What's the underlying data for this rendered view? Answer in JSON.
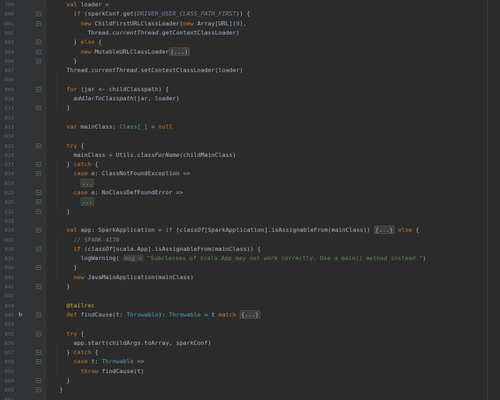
{
  "editor": {
    "lines": [
      {
        "n": "799",
        "fold": false,
        "segs": [
          {
            "c": "      "
          },
          {
            "c": "val",
            "k": "kw"
          },
          {
            "c": " loader ="
          }
        ]
      },
      {
        "n": "800",
        "fold": true,
        "segs": [
          {
            "c": "        "
          },
          {
            "c": "if",
            "k": "kw"
          },
          {
            "c": " (sparkConf.get("
          },
          {
            "c": "DRIVER_USER_CLASS_PATH_FIRST",
            "k": "const"
          },
          {
            "c": ")) {"
          }
        ]
      },
      {
        "n": "801",
        "fold": true,
        "segs": [
          {
            "c": "          "
          },
          {
            "c": "new",
            "k": "kw"
          },
          {
            "c": " ChildFirstURLClassLoader("
          },
          {
            "c": "new",
            "k": "kw"
          },
          {
            "c": " Array[URL]("
          },
          {
            "c": "0",
            "k": "num"
          },
          {
            "c": "),"
          }
        ]
      },
      {
        "n": "802",
        "fold": false,
        "segs": [
          {
            "c": "            Thread."
          },
          {
            "c": "currentThread",
            "k": "it"
          },
          {
            "c": ".getContextClassLoader)"
          }
        ]
      },
      {
        "n": "803",
        "fold": true,
        "segs": [
          {
            "c": "        } "
          },
          {
            "c": "else",
            "k": "kw"
          },
          {
            "c": " {"
          }
        ]
      },
      {
        "n": "804",
        "fold": true,
        "segs": [
          {
            "c": "          "
          },
          {
            "c": "new",
            "k": "kw"
          },
          {
            "c": " MutableURLClassLoader"
          },
          {
            "c": "(...)",
            "k": "fold"
          }
        ]
      },
      {
        "n": "806",
        "fold": true,
        "segs": [
          {
            "c": "        }"
          }
        ]
      },
      {
        "n": "807",
        "fold": false,
        "segs": [
          {
            "c": "      Thread."
          },
          {
            "c": "currentThread",
            "k": "it"
          },
          {
            "c": ".setContextClassLoader(loader)"
          }
        ]
      },
      {
        "n": "808",
        "fold": false,
        "segs": []
      },
      {
        "n": "809",
        "fold": true,
        "segs": [
          {
            "c": "      "
          },
          {
            "c": "for",
            "k": "kw"
          },
          {
            "c": " (jar <- childClasspath) {"
          }
        ]
      },
      {
        "n": "810",
        "fold": false,
        "segs": [
          {
            "c": "        "
          },
          {
            "c": "addJarToClasspath",
            "k": "it"
          },
          {
            "c": "(jar, loader)"
          }
        ]
      },
      {
        "n": "811",
        "fold": true,
        "segs": [
          {
            "c": "      }"
          }
        ]
      },
      {
        "n": "812",
        "fold": false,
        "segs": []
      },
      {
        "n": "813",
        "fold": false,
        "segs": [
          {
            "c": "      "
          },
          {
            "c": "var",
            "k": "kw"
          },
          {
            "c": " mainClass: "
          },
          {
            "c": "Class[_]",
            "k": "tp"
          },
          {
            "c": " = "
          },
          {
            "c": "null",
            "k": "kw"
          }
        ]
      },
      {
        "n": "814",
        "fold": false,
        "segs": []
      },
      {
        "n": "815",
        "fold": true,
        "segs": [
          {
            "c": "      "
          },
          {
            "c": "try",
            "k": "kw"
          },
          {
            "c": " {"
          }
        ]
      },
      {
        "n": "816",
        "fold": false,
        "segs": [
          {
            "c": "        mainClass = Utils."
          },
          {
            "c": "classForName",
            "k": "it"
          },
          {
            "c": "(childMainClass)"
          }
        ]
      },
      {
        "n": "817",
        "fold": true,
        "segs": [
          {
            "c": "      } "
          },
          {
            "c": "catch",
            "k": "kw"
          },
          {
            "c": " {"
          }
        ]
      },
      {
        "n": "818",
        "fold": true,
        "segs": [
          {
            "c": "        "
          },
          {
            "c": "case",
            "k": "kw"
          },
          {
            "c": " e: ClassNotFoundException =>"
          }
        ]
      },
      {
        "n": "819",
        "fold": false,
        "segs": [
          {
            "c": "          "
          },
          {
            "c": "...",
            "k": "fold"
          }
        ]
      },
      {
        "n": "825",
        "fold": true,
        "segs": [
          {
            "c": "        "
          },
          {
            "c": "case",
            "k": "kw"
          },
          {
            "c": " e: NoClassDefFoundError =>"
          }
        ]
      },
      {
        "n": "826",
        "fold": true,
        "segs": [
          {
            "c": "          "
          },
          {
            "c": "...",
            "k": "fold"
          }
        ]
      },
      {
        "n": "832",
        "fold": true,
        "segs": [
          {
            "c": "      }"
          }
        ]
      },
      {
        "n": "833",
        "fold": false,
        "segs": []
      },
      {
        "n": "834",
        "fold": true,
        "segs": [
          {
            "c": "      "
          },
          {
            "c": "val",
            "k": "kw"
          },
          {
            "c": " app: SparkApplication = "
          },
          {
            "c": "if",
            "k": "kw"
          },
          {
            "c": " ("
          },
          {
            "c": "classOf",
            "k": "it"
          },
          {
            "c": "[SparkApplication].isAssignableFrom(mainClass)) "
          },
          {
            "c": "{...}",
            "k": "fold"
          },
          {
            "c": " "
          },
          {
            "c": "else",
            "k": "kw"
          },
          {
            "c": " {"
          }
        ]
      },
      {
        "n": "837",
        "fold": false,
        "segs": [
          {
            "c": "        "
          },
          {
            "c": "// SPARK-4170",
            "k": "cm"
          }
        ]
      },
      {
        "n": "838",
        "fold": true,
        "segs": [
          {
            "c": "        "
          },
          {
            "c": "if",
            "k": "kw"
          },
          {
            "c": " ("
          },
          {
            "c": "classOf",
            "k": "it"
          },
          {
            "c": "[scala.App].isAssignableFrom(mainClass)) {"
          }
        ]
      },
      {
        "n": "839",
        "fold": false,
        "segs": [
          {
            "c": "          logWarning( "
          },
          {
            "c": "msg =",
            "k": "hint"
          },
          {
            "c": " "
          },
          {
            "c": "\"Subclasses of scala.App may not work correctly. Use a main() method instead.\"",
            "k": "str"
          },
          {
            "c": ")"
          }
        ]
      },
      {
        "n": "840",
        "fold": true,
        "segs": [
          {
            "c": "        }"
          }
        ]
      },
      {
        "n": "841",
        "fold": false,
        "segs": [
          {
            "c": "        "
          },
          {
            "c": "new",
            "k": "kw"
          },
          {
            "c": " JavaMainApplication(mainClass)"
          }
        ]
      },
      {
        "n": "842",
        "fold": true,
        "segs": [
          {
            "c": "      }"
          }
        ]
      },
      {
        "n": "843",
        "fold": false,
        "segs": []
      },
      {
        "n": "844",
        "fold": false,
        "segs": [
          {
            "c": "      "
          },
          {
            "c": "@tailrec",
            "k": "ann"
          }
        ]
      },
      {
        "n": "845",
        "fold": true,
        "rec": true,
        "segs": [
          {
            "c": "      "
          },
          {
            "c": "def",
            "k": "kw"
          },
          {
            "c": " findCause(t: "
          },
          {
            "c": "Throwable",
            "k": "tp"
          },
          {
            "c": "): "
          },
          {
            "c": "Throwable",
            "k": "tp"
          },
          {
            "c": " = t "
          },
          {
            "c": "match",
            "k": "kw"
          },
          {
            "c": " "
          },
          {
            "c": "{...}",
            "k": "fold"
          }
        ]
      },
      {
        "n": "854",
        "fold": false,
        "segs": []
      },
      {
        "n": "855",
        "fold": true,
        "segs": [
          {
            "c": "      "
          },
          {
            "c": "try",
            "k": "kw"
          },
          {
            "c": " {"
          }
        ]
      },
      {
        "n": "856",
        "fold": false,
        "segs": [
          {
            "c": "        app.start(childArgs.toArray, sparkConf)"
          }
        ]
      },
      {
        "n": "857",
        "fold": true,
        "segs": [
          {
            "c": "      } "
          },
          {
            "c": "catch",
            "k": "kw"
          },
          {
            "c": " {"
          }
        ]
      },
      {
        "n": "858",
        "fold": true,
        "segs": [
          {
            "c": "        "
          },
          {
            "c": "case",
            "k": "kw"
          },
          {
            "c": " t: "
          },
          {
            "c": "Throwable",
            "k": "tp"
          },
          {
            "c": " =>"
          }
        ]
      },
      {
        "n": "859",
        "fold": false,
        "segs": [
          {
            "c": "          "
          },
          {
            "c": "throw",
            "k": "kw"
          },
          {
            "c": " findCause(t)"
          }
        ]
      },
      {
        "n": "860",
        "fold": true,
        "segs": [
          {
            "c": "      }"
          }
        ]
      },
      {
        "n": "860",
        "fold": true,
        "segs": [
          {
            "c": "    }"
          }
        ]
      },
      {
        "n": "861",
        "fold": false,
        "segs": []
      }
    ]
  }
}
